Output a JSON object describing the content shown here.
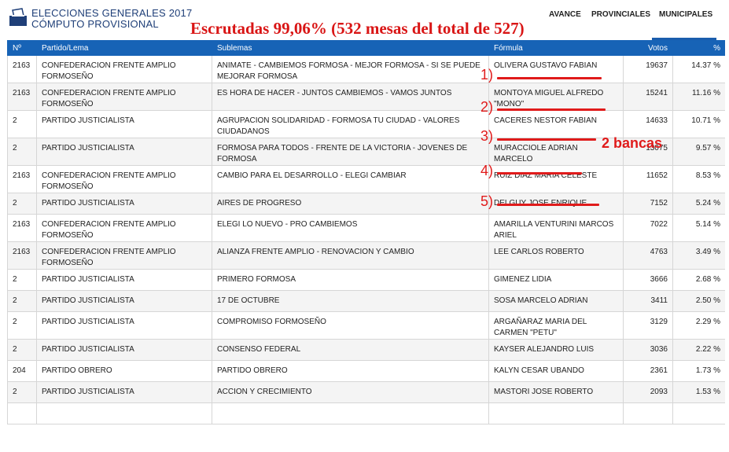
{
  "header": {
    "title_line1": "ELECCIONES GENERALES 2017",
    "title_line2": "CÓMPUTO PROVISIONAL",
    "logo_icon": "ballot-box-icon",
    "scrutiny_note": "Escrutadas 99,06% (532 mesas del total de 527)",
    "nav": [
      "AVANCE",
      "PROVINCIALES",
      "MUNICIPALES"
    ],
    "active_nav": "MUNICIPALES"
  },
  "table": {
    "columns": [
      "Nº",
      "Partido/Lema",
      "Sublemas",
      "Fórmula",
      "Votos",
      "%"
    ],
    "rows": [
      [
        "2163",
        "CONFEDERACION FRENTE AMPLIO FORMOSEÑO",
        "ANIMATE - CAMBIEMOS FORMOSA - MEJOR FORMOSA - SI SE PUEDE MEJORAR FORMOSA",
        "OLIVERA GUSTAVO FABIAN",
        "19637",
        "14.37 %"
      ],
      [
        "2163",
        "CONFEDERACION FRENTE AMPLIO FORMOSEÑO",
        "ES HORA DE HACER - JUNTOS CAMBIEMOS - VAMOS JUNTOS",
        "MONTOYA MIGUEL ALFREDO \"MONO\"",
        "15241",
        "11.16 %"
      ],
      [
        "2",
        "PARTIDO JUSTICIALISTA",
        "AGRUPACION SOLIDARIDAD - FORMOSA TU CIUDAD - VALORES CIUDADANOS",
        "CACERES NESTOR FABIAN",
        "14633",
        "10.71 %"
      ],
      [
        "2",
        "PARTIDO JUSTICIALISTA",
        "FORMOSA PARA TODOS - FRENTE DE LA VICTORIA - JOVENES DE FORMOSA",
        "MURACCIOLE ADRIAN MARCELO",
        "13075",
        "9.57 %"
      ],
      [
        "2163",
        "CONFEDERACION FRENTE AMPLIO FORMOSEÑO",
        "CAMBIO PARA EL DESARROLLO - ELEGI CAMBIAR",
        "RUIZ DIAZ MARIA CELESTE",
        "11652",
        "8.53 %"
      ],
      [
        "2",
        "PARTIDO JUSTICIALISTA",
        "AIRES DE PROGRESO",
        "DELGUY JOSE ENRIQUE",
        "7152",
        "5.24 %"
      ],
      [
        "2163",
        "CONFEDERACION FRENTE AMPLIO FORMOSEÑO",
        "ELEGI LO NUEVO - PRO CAMBIEMOS",
        "AMARILLA VENTURINI MARCOS ARIEL",
        "7022",
        "5.14 %"
      ],
      [
        "2163",
        "CONFEDERACION FRENTE AMPLIO FORMOSEÑO",
        "ALIANZA FRENTE AMPLIO - RENOVACION Y CAMBIO",
        "LEE CARLOS ROBERTO",
        "4763",
        "3.49 %"
      ],
      [
        "2",
        "PARTIDO JUSTICIALISTA",
        "PRIMERO FORMOSA",
        "GIMENEZ LIDIA",
        "3666",
        "2.68 %"
      ],
      [
        "2",
        "PARTIDO JUSTICIALISTA",
        "17 DE OCTUBRE",
        "SOSA MARCELO ADRIAN",
        "3411",
        "2.50 %"
      ],
      [
        "2",
        "PARTIDO JUSTICIALISTA",
        "COMPROMISO FORMOSEÑO",
        "ARGAÑARAZ MARIA DEL CARMEN \"PETU\"",
        "3129",
        "2.29 %"
      ],
      [
        "2",
        "PARTIDO JUSTICIALISTA",
        "CONSENSO FEDERAL",
        "KAYSER ALEJANDRO LUIS",
        "3036",
        "2.22 %"
      ],
      [
        "204",
        "PARTIDO OBRERO",
        "PARTIDO OBRERO",
        "KALYN CESAR UBANDO",
        "2361",
        "1.73 %"
      ],
      [
        "2",
        "PARTIDO JUSTICIALISTA",
        "ACCION Y CRECIMIENTO",
        "MASTORI JOSE ROBERTO",
        "2093",
        "1.53 %"
      ],
      [
        "",
        "",
        "",
        "",
        "",
        ""
      ]
    ],
    "single_line_rows": [
      5,
      8,
      9,
      11,
      12,
      13,
      14
    ]
  },
  "annotations": {
    "markers": [
      "1)",
      "2)",
      "3)",
      "4)",
      "5)"
    ],
    "bancas_note": "2 bancas",
    "color": "#e01b1b"
  },
  "colors": {
    "brand_blue": "#1763b6",
    "title_navy": "#1f3f78",
    "scrutiny_red": "#d91515"
  }
}
